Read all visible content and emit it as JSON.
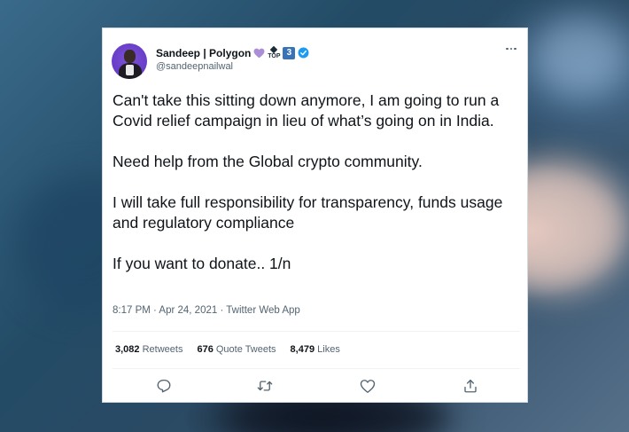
{
  "tweet": {
    "display_name": "Sandeep | Polygon",
    "badges": {
      "heart": "purple-heart",
      "top_label": "TOP",
      "rank": "3",
      "verified": "verified-checkmark"
    },
    "handle": "@sandeepnailwal",
    "paragraphs": [
      "Can't take this sitting down anymore, I am going to run a Covid relief campaign in lieu of what’s going on in India.",
      "Need help from the Global crypto community.",
      "I will take full responsibility for transparency, funds usage and regulatory compliance",
      "If you want to donate.. 1/n"
    ],
    "timestamp": "8:17 PM · Apr 24, 2021 · Twitter Web App",
    "stats": {
      "retweets_count": "3,082",
      "retweets_label": "Retweets",
      "quotes_count": "676",
      "quotes_label": "Quote Tweets",
      "likes_count": "8,479",
      "likes_label": "Likes"
    },
    "actions": [
      "reply-icon",
      "retweet-icon",
      "like-icon",
      "share-icon"
    ]
  },
  "colors": {
    "text_primary": "#0f1419",
    "text_secondary": "#536471",
    "verified_blue": "#1d9bf0",
    "heart_purple": "#aa8ed6",
    "rank_blue": "#3873b8",
    "card_border": "#cfd9de"
  }
}
